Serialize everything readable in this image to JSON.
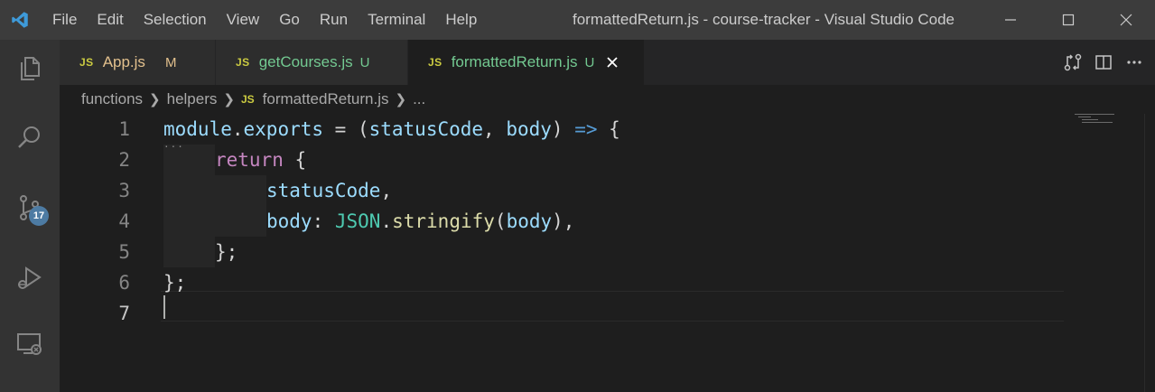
{
  "titlebar": {
    "menu": [
      "File",
      "Edit",
      "Selection",
      "View",
      "Go",
      "Run",
      "Terminal",
      "Help"
    ],
    "window_title": "formattedReturn.js - course-tracker - Visual Studio Code"
  },
  "activitybar": {
    "icons": [
      "explorer-icon",
      "search-icon",
      "source-control-icon",
      "run-debug-icon",
      "remote-explorer-icon"
    ],
    "source_control_badge": "17"
  },
  "tabs": [
    {
      "lang": "JS",
      "name": "App.js",
      "status": "M",
      "active": false
    },
    {
      "lang": "JS",
      "name": "getCourses.js",
      "status": "U",
      "active": false
    },
    {
      "lang": "JS",
      "name": "formattedReturn.js",
      "status": "U",
      "active": true
    }
  ],
  "breadcrumb": {
    "parts": [
      "functions",
      "helpers"
    ],
    "file_lang": "JS",
    "file": "formattedReturn.js",
    "tail": "..."
  },
  "editor": {
    "line_numbers": [
      "1",
      "2",
      "3",
      "4",
      "5",
      "6",
      "7"
    ],
    "current_line": 7,
    "code": {
      "l1_module": "module",
      "l1_dot": ".",
      "l1_exports": "exports",
      "l1_assign": " = (",
      "l1_p1": "statusCode",
      "l1_comma": ", ",
      "l1_p2": "body",
      "l1_close": ") ",
      "l1_arrow": "=>",
      "l1_brace": " {",
      "l2_return": "return",
      "l2_brace": " {",
      "l3_key": "statusCode",
      "l3_comma": ",",
      "l4_key": "body",
      "l4_colon": ": ",
      "l4_json": "JSON",
      "l4_dot": ".",
      "l4_fn": "stringify",
      "l4_open": "(",
      "l4_arg": "body",
      "l4_close": "),",
      "l5": "};",
      "l6": "};"
    },
    "fold_marker": "···"
  },
  "colors": {
    "titlebar_bg": "#3c3c3c",
    "activitybar_bg": "#333333",
    "editor_bg": "#1e1e1e",
    "badge_bg": "#4d7ba3",
    "js_label": "#cbcb41",
    "modified_label": "#e2c08d"
  }
}
